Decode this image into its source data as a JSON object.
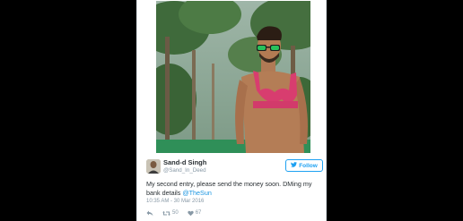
{
  "tweet": {
    "display_name": "Sand-d Singh",
    "handle": "@Sand_In_Deed",
    "follow_label": "Follow",
    "text_main": "My second entry, please send the money soon. DMing my bank details ",
    "text_mention": "@TheSun",
    "timestamp": "10:35 AM - 30 Mar 2016",
    "retweets": "50",
    "likes": "67"
  },
  "icons": {
    "reply": "reply-icon",
    "retweet": "retweet-icon",
    "like": "heart-icon",
    "follow": "bird-icon"
  },
  "colors": {
    "accent": "#1da1f2",
    "text": "#292f33",
    "muted": "#8899a6",
    "background": "#000000"
  }
}
